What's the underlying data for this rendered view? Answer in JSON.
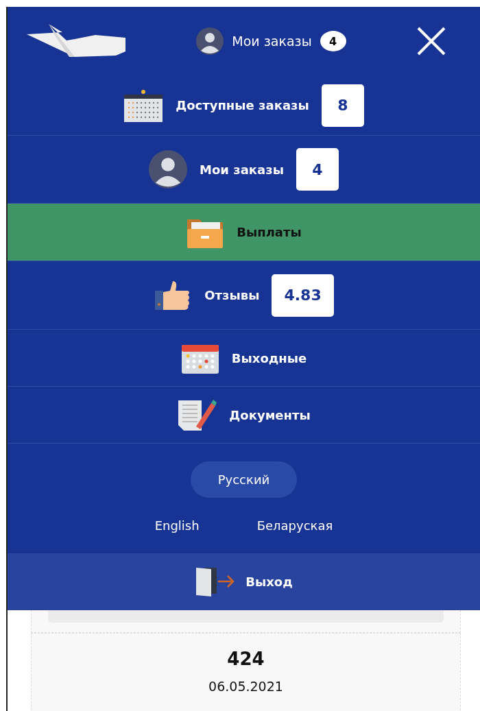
{
  "header": {
    "my_orders_label": "Мои заказы",
    "my_orders_count": "4"
  },
  "menu": [
    {
      "kind": "calendar",
      "label": "Доступные заказы",
      "badge": "8",
      "selected": false
    },
    {
      "kind": "user",
      "label": "Мои заказы",
      "badge": "4",
      "selected": false
    },
    {
      "kind": "folder",
      "label": "Выплаты",
      "selected": true
    },
    {
      "kind": "thumb",
      "label": "Отзывы",
      "badge": "4.83",
      "selected": false
    },
    {
      "kind": "holiday",
      "label": "Выходные",
      "selected": false
    },
    {
      "kind": "document",
      "label": "Документы",
      "selected": false
    }
  ],
  "languages": [
    {
      "label": "Русский",
      "selected": true
    },
    {
      "label": "English",
      "selected": false
    },
    {
      "label": "Беларуская",
      "selected": false
    }
  ],
  "logout": {
    "label": "Выход"
  },
  "order": {
    "number": "424",
    "date": "06.05.2021"
  }
}
